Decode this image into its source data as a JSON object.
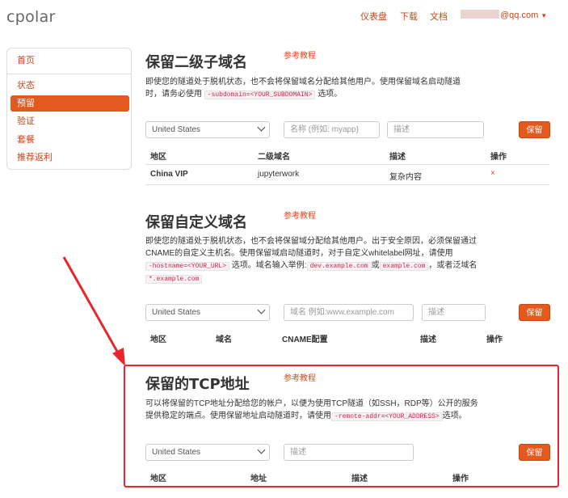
{
  "app": {
    "logo": "cpolar"
  },
  "topnav": {
    "dashboard": "仪表盘",
    "download": "下载",
    "docs": "文档",
    "user_email_suffix": "@qq.com"
  },
  "sidebar": {
    "items": [
      {
        "label": "首页"
      },
      {
        "label": "状态"
      },
      {
        "label": "预留"
      },
      {
        "label": "验证"
      },
      {
        "label": "套餐"
      },
      {
        "label": "推荐返利"
      }
    ]
  },
  "subdomain": {
    "title": "保留二级子域名",
    "ref_link": "参考教程",
    "desc_line1": "即使您的隧道处于脱机状态，也不会将保留域名分配给其他用户。使用保留域名启动隧道",
    "desc_line2_pre": "时，请务必使用",
    "desc_code": "-subdomain=<YOUR_SUBDOMAIN>",
    "desc_line2_post": "选项。",
    "region_select": "United States",
    "name_placeholder": "名称 (例如: myapp)",
    "desc_placeholder": "描述",
    "save_label": "保留",
    "columns": [
      "地区",
      "二级域名",
      "描述",
      "操作"
    ],
    "rows": [
      {
        "region": "China VIP",
        "subdomain": "jupyterwork",
        "description": "复杂内容",
        "action": "×"
      }
    ]
  },
  "custom_domain": {
    "title": "保留自定义域名",
    "ref_link": "参考教程",
    "desc_line1": "即使您的隧道处于脱机状态，也不会将保留域分配给其他用户。出于安全原因，必须保留通过",
    "desc_line2": "CNAME的自定义主机名。使用保留域启动隧道时，对于自定义whitelabel网址，请使用",
    "desc_code1": "-hostname=<YOUR_URL>",
    "desc_line3_mid": "选项。域名输入举例:",
    "desc_code2": "dev.example.com",
    "desc_or": "或",
    "desc_code3": "example.com",
    "desc_line3_post": "，或者泛域名",
    "desc_code4": "*.example.com",
    "region_select": "United States",
    "domain_placeholder": "域名 例如:www.example.com",
    "desc_placeholder": "描述",
    "save_label": "保留",
    "columns": [
      "地区",
      "域名",
      "CNAME配置",
      "描述",
      "操作"
    ]
  },
  "tcp": {
    "title": "保留的TCP地址",
    "ref_link": "参考教程",
    "desc_line1": "可以将保留的TCP地址分配给您的帐户，以便为使用TCP隧道（如SSH，RDP等）公开的服务",
    "desc_line2_pre": "提供稳定的端点。使用保留地址启动隧道时，请使用",
    "desc_code": "-remote-addr=<YOUR_ADDRESS>",
    "desc_line2_post": "选项。",
    "region_select": "United States",
    "desc_placeholder": "描述",
    "save_label": "保留",
    "columns": [
      "地区",
      "地址",
      "描述",
      "操作"
    ]
  },
  "colors": {
    "accent": "#e25a1e",
    "link": "#c7461b",
    "annotation_red": "#e8262b"
  }
}
